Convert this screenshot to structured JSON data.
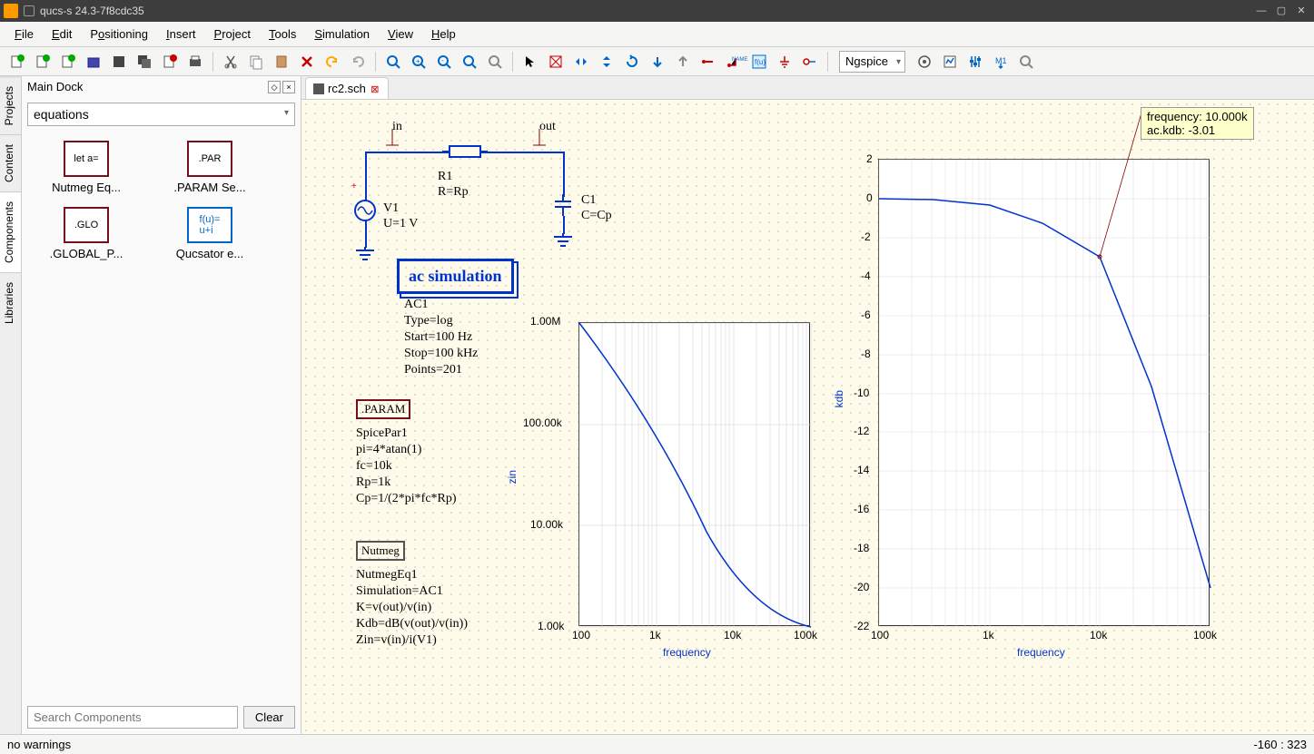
{
  "window": {
    "title": "qucs-s 24.3-7f8cdc35"
  },
  "menu": [
    "File",
    "Edit",
    "Positioning",
    "Insert",
    "Project",
    "Tools",
    "Simulation",
    "View",
    "Help"
  ],
  "toolbar": {
    "simulator": "Ngspice"
  },
  "dock": {
    "title": "Main Dock",
    "category": "equations",
    "components": [
      {
        "icon": "let a=",
        "label": "Nutmeg Eq...",
        "kind": "red"
      },
      {
        "icon": ".PAR",
        "label": ".PARAM Se...",
        "kind": "red"
      },
      {
        "icon": ".GLO",
        "label": ".GLOBAL_P...",
        "kind": "red"
      },
      {
        "icon": "f(u)=\nu+i",
        "label": "Qucsator e...",
        "kind": "blue"
      }
    ],
    "search_placeholder": "Search Components",
    "clear_label": "Clear"
  },
  "side_tabs": [
    "Projects",
    "Content",
    "Components",
    "Libraries"
  ],
  "file_tab": "rc2.sch",
  "schematic": {
    "in_label": "in",
    "out_label": "out",
    "R": {
      "name": "R1",
      "val": "R=Rp"
    },
    "V": {
      "name": "V1",
      "val": "U=1 V"
    },
    "C": {
      "name": "C1",
      "val": "C=Cp"
    },
    "sim_title": "ac simulation",
    "sim_params": [
      "AC1",
      "Type=log",
      "Start=100 Hz",
      "Stop=100 kHz",
      "Points=201"
    ],
    "param_title": ".PARAM",
    "param_lines": [
      "SpicePar1",
      "pi=4*atan(1)",
      "fc=10k",
      "Rp=1k",
      "Cp=1/(2*pi*fc*Rp)"
    ],
    "nutmeg_title": "Nutmeg",
    "nutmeg_lines": [
      "NutmegEq1",
      "Simulation=AC1",
      "K=v(out)/v(in)",
      "Kdb=dB(v(out)/v(in))",
      "Zin=v(in)/i(V1)"
    ]
  },
  "chart_data": [
    {
      "type": "line",
      "title": "",
      "xlabel": "frequency",
      "ylabel": "zin",
      "xscale": "log",
      "yscale": "log",
      "xlim": [
        100,
        100000
      ],
      "ylim": [
        1000,
        1000000
      ],
      "x_ticks": [
        "100",
        "1k",
        "10k",
        "100k"
      ],
      "y_ticks": [
        "1.00k",
        "10.00k",
        "100.00k",
        "1.00M"
      ],
      "x": [
        100,
        300,
        1000,
        3000,
        10000,
        30000,
        100000
      ],
      "values": [
        1000000,
        330000,
        100000,
        33000,
        10000,
        3300,
        1000
      ]
    },
    {
      "type": "line",
      "title": "",
      "xlabel": "frequency",
      "ylabel": "kdb",
      "xscale": "log",
      "yscale": "linear",
      "xlim": [
        100,
        100000
      ],
      "ylim": [
        -22,
        2
      ],
      "x_ticks": [
        "100",
        "1k",
        "10k",
        "100k"
      ],
      "y_ticks": [
        "2",
        "0",
        "-2",
        "-4",
        "-6",
        "-8",
        "-10",
        "-12",
        "-14",
        "-16",
        "-18",
        "-20",
        "-22"
      ],
      "x": [
        100,
        300,
        1000,
        3000,
        10000,
        30000,
        100000
      ],
      "values": [
        0,
        -0.05,
        -0.4,
        -1.3,
        -3.01,
        -10,
        -20
      ],
      "cursor": {
        "frequency": "10.000k",
        "ac_kdb": "-3.01"
      }
    }
  ],
  "status": {
    "left": "no warnings",
    "right": "-160 : 323"
  }
}
